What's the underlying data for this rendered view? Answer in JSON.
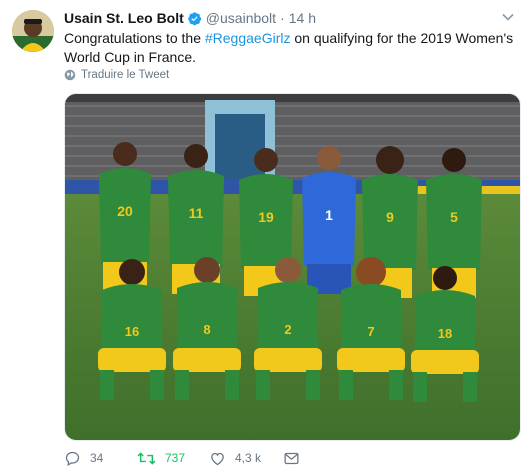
{
  "tweet": {
    "display_name": "Usain St. Leo Bolt",
    "handle": "@usainbolt",
    "separator": "·",
    "time": "14 h",
    "text_before": "Congratulations to the ",
    "hashtag": "#ReggaeGirlz",
    "text_after": " on qualifying for the 2019 Women's World Cup in France.",
    "translate_label": "Traduire le Tweet"
  },
  "photo": {
    "players_back_row": [
      "20",
      "11",
      "19",
      "1",
      "9",
      "5"
    ],
    "players_front_row": [
      "16",
      "8",
      "2",
      "7",
      "18"
    ]
  },
  "actions": {
    "reply_count": "34",
    "retweet_count": "737",
    "like_count": "4,3 k"
  },
  "colors": {
    "accent": "#1b95e0",
    "retweet": "#17bf63",
    "secondary_text": "#657786",
    "kit_green": "#2f8a3c",
    "kit_yellow": "#f2c81a",
    "keeper_blue": "#2f68d8"
  },
  "icons": [
    "verified-badge-icon",
    "chevron-down-icon",
    "globe-icon",
    "reply-icon",
    "retweet-icon",
    "like-icon",
    "dm-icon"
  ]
}
